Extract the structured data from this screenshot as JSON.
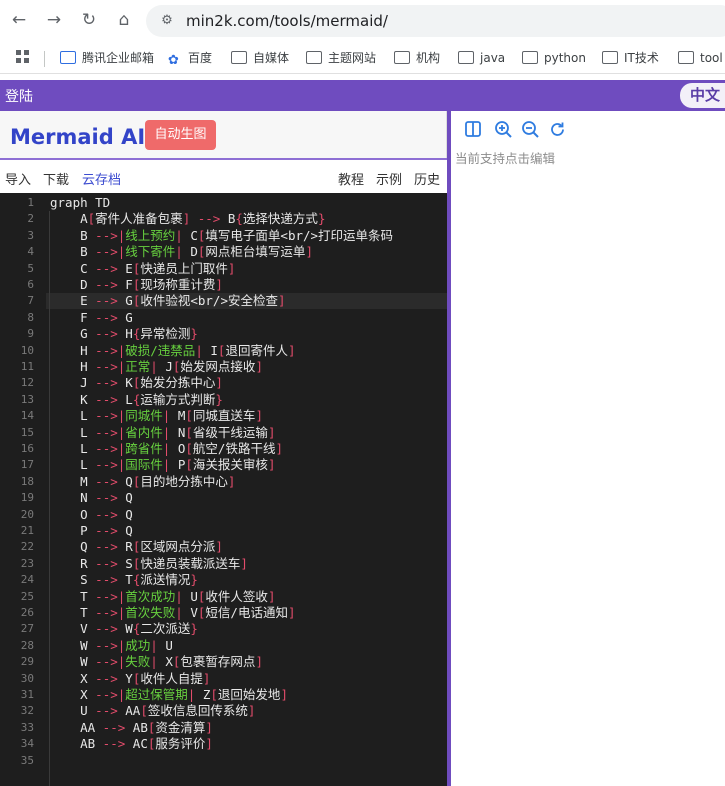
{
  "browser": {
    "url": "min2k.com/tools/mermaid/",
    "bookmarks": [
      "腾讯企业邮箱",
      "百度",
      "自媒体",
      "主题网站",
      "机构",
      "java",
      "python",
      "IT技术",
      "tool"
    ]
  },
  "app": {
    "login": "登陆",
    "lang": "中文",
    "brand": "Mermaid AI",
    "auto_button": "自动生图",
    "menu_left": [
      "导入",
      "下载",
      "云存档"
    ],
    "menu_right": [
      "教程",
      "示例",
      "历史"
    ],
    "hint": "当前支持点击编辑"
  },
  "code_lines": [
    [
      [
        "node",
        "graph TD"
      ]
    ],
    [
      [
        "node",
        "    A"
      ],
      [
        "br",
        "["
      ],
      [
        "text",
        "寄件人准备包裹"
      ],
      [
        "br",
        "]"
      ],
      [
        "arrow",
        " --> "
      ],
      [
        "node",
        "B"
      ],
      [
        "br",
        "{"
      ],
      [
        "text",
        "选择快递方式"
      ],
      [
        "br",
        "}"
      ]
    ],
    [
      [
        "node",
        "    B"
      ],
      [
        "arrow",
        " -->"
      ],
      [
        "br",
        "|"
      ],
      [
        "label",
        "线上预约"
      ],
      [
        "br",
        "|"
      ],
      [
        "node",
        " C"
      ],
      [
        "br",
        "["
      ],
      [
        "text",
        "填写电子面单<br/>打印运单条码"
      ]
    ],
    [
      [
        "node",
        "    B"
      ],
      [
        "arrow",
        " -->"
      ],
      [
        "br",
        "|"
      ],
      [
        "label",
        "线下寄件"
      ],
      [
        "br",
        "|"
      ],
      [
        "node",
        " D"
      ],
      [
        "br",
        "["
      ],
      [
        "text",
        "网点柜台填写运单"
      ],
      [
        "br",
        "]"
      ]
    ],
    [
      [
        "node",
        "    C"
      ],
      [
        "arrow",
        " --> "
      ],
      [
        "node",
        "E"
      ],
      [
        "br",
        "["
      ],
      [
        "text",
        "快递员上门取件"
      ],
      [
        "br",
        "]"
      ]
    ],
    [
      [
        "node",
        "    D"
      ],
      [
        "arrow",
        " --> "
      ],
      [
        "node",
        "F"
      ],
      [
        "br",
        "["
      ],
      [
        "text",
        "现场称重计费"
      ],
      [
        "br",
        "]"
      ]
    ],
    [
      [
        "node",
        "    E"
      ],
      [
        "arrow",
        " --> "
      ],
      [
        "node",
        "G"
      ],
      [
        "br",
        "["
      ],
      [
        "text",
        "收件验视<br/>安全检查"
      ],
      [
        "br",
        "]"
      ]
    ],
    [
      [
        "node",
        "    F"
      ],
      [
        "arrow",
        " --> "
      ],
      [
        "node",
        "G"
      ]
    ],
    [
      [
        "node",
        "    G"
      ],
      [
        "arrow",
        " --> "
      ],
      [
        "node",
        "H"
      ],
      [
        "br",
        "{"
      ],
      [
        "text",
        "异常检测"
      ],
      [
        "br",
        "}"
      ]
    ],
    [
      [
        "node",
        "    H"
      ],
      [
        "arrow",
        " -->"
      ],
      [
        "br",
        "|"
      ],
      [
        "label",
        "破损/违禁品"
      ],
      [
        "br",
        "|"
      ],
      [
        "node",
        " I"
      ],
      [
        "br",
        "["
      ],
      [
        "text",
        "退回寄件人"
      ],
      [
        "br",
        "]"
      ]
    ],
    [
      [
        "node",
        "    H"
      ],
      [
        "arrow",
        " -->"
      ],
      [
        "br",
        "|"
      ],
      [
        "label",
        "正常"
      ],
      [
        "br",
        "|"
      ],
      [
        "node",
        " J"
      ],
      [
        "br",
        "["
      ],
      [
        "text",
        "始发网点接收"
      ],
      [
        "br",
        "]"
      ]
    ],
    [
      [
        "node",
        "    J"
      ],
      [
        "arrow",
        " --> "
      ],
      [
        "node",
        "K"
      ],
      [
        "br",
        "["
      ],
      [
        "text",
        "始发分拣中心"
      ],
      [
        "br",
        "]"
      ]
    ],
    [
      [
        "node",
        "    K"
      ],
      [
        "arrow",
        " --> "
      ],
      [
        "node",
        "L"
      ],
      [
        "br",
        "{"
      ],
      [
        "text",
        "运输方式判断"
      ],
      [
        "br",
        "}"
      ]
    ],
    [
      [
        "node",
        "    L"
      ],
      [
        "arrow",
        " -->"
      ],
      [
        "br",
        "|"
      ],
      [
        "label",
        "同城件"
      ],
      [
        "br",
        "|"
      ],
      [
        "node",
        " M"
      ],
      [
        "br",
        "["
      ],
      [
        "text",
        "同城直送车"
      ],
      [
        "br",
        "]"
      ]
    ],
    [
      [
        "node",
        "    L"
      ],
      [
        "arrow",
        " -->"
      ],
      [
        "br",
        "|"
      ],
      [
        "label",
        "省内件"
      ],
      [
        "br",
        "|"
      ],
      [
        "node",
        " N"
      ],
      [
        "br",
        "["
      ],
      [
        "text",
        "省级干线运输"
      ],
      [
        "br",
        "]"
      ]
    ],
    [
      [
        "node",
        "    L"
      ],
      [
        "arrow",
        " -->"
      ],
      [
        "br",
        "|"
      ],
      [
        "label",
        "跨省件"
      ],
      [
        "br",
        "|"
      ],
      [
        "node",
        " O"
      ],
      [
        "br",
        "["
      ],
      [
        "text",
        "航空/铁路干线"
      ],
      [
        "br",
        "]"
      ]
    ],
    [
      [
        "node",
        "    L"
      ],
      [
        "arrow",
        " -->"
      ],
      [
        "br",
        "|"
      ],
      [
        "label",
        "国际件"
      ],
      [
        "br",
        "|"
      ],
      [
        "node",
        " P"
      ],
      [
        "br",
        "["
      ],
      [
        "text",
        "海关报关审核"
      ],
      [
        "br",
        "]"
      ]
    ],
    [
      [
        "node",
        "    M"
      ],
      [
        "arrow",
        " --> "
      ],
      [
        "node",
        "Q"
      ],
      [
        "br",
        "["
      ],
      [
        "text",
        "目的地分拣中心"
      ],
      [
        "br",
        "]"
      ]
    ],
    [
      [
        "node",
        "    N"
      ],
      [
        "arrow",
        " --> "
      ],
      [
        "node",
        "Q"
      ]
    ],
    [
      [
        "node",
        "    O"
      ],
      [
        "arrow",
        " --> "
      ],
      [
        "node",
        "Q"
      ]
    ],
    [
      [
        "node",
        "    P"
      ],
      [
        "arrow",
        " --> "
      ],
      [
        "node",
        "Q"
      ]
    ],
    [
      [
        "node",
        "    Q"
      ],
      [
        "arrow",
        " --> "
      ],
      [
        "node",
        "R"
      ],
      [
        "br",
        "["
      ],
      [
        "text",
        "区域网点分派"
      ],
      [
        "br",
        "]"
      ]
    ],
    [
      [
        "node",
        "    R"
      ],
      [
        "arrow",
        " --> "
      ],
      [
        "node",
        "S"
      ],
      [
        "br",
        "["
      ],
      [
        "text",
        "快递员装载派送车"
      ],
      [
        "br",
        "]"
      ]
    ],
    [
      [
        "node",
        "    S"
      ],
      [
        "arrow",
        " --> "
      ],
      [
        "node",
        "T"
      ],
      [
        "br",
        "{"
      ],
      [
        "text",
        "派送情况"
      ],
      [
        "br",
        "}"
      ]
    ],
    [
      [
        "node",
        "    T"
      ],
      [
        "arrow",
        " -->"
      ],
      [
        "br",
        "|"
      ],
      [
        "label",
        "首次成功"
      ],
      [
        "br",
        "|"
      ],
      [
        "node",
        " U"
      ],
      [
        "br",
        "["
      ],
      [
        "text",
        "收件人签收"
      ],
      [
        "br",
        "]"
      ]
    ],
    [
      [
        "node",
        "    T"
      ],
      [
        "arrow",
        " -->"
      ],
      [
        "br",
        "|"
      ],
      [
        "label",
        "首次失败"
      ],
      [
        "br",
        "|"
      ],
      [
        "node",
        " V"
      ],
      [
        "br",
        "["
      ],
      [
        "text",
        "短信/电话通知"
      ],
      [
        "br",
        "]"
      ]
    ],
    [
      [
        "node",
        "    V"
      ],
      [
        "arrow",
        " --> "
      ],
      [
        "node",
        "W"
      ],
      [
        "br",
        "{"
      ],
      [
        "text",
        "二次派送"
      ],
      [
        "br",
        "}"
      ]
    ],
    [
      [
        "node",
        "    W"
      ],
      [
        "arrow",
        " -->"
      ],
      [
        "br",
        "|"
      ],
      [
        "label",
        "成功"
      ],
      [
        "br",
        "|"
      ],
      [
        "node",
        " U"
      ]
    ],
    [
      [
        "node",
        "    W"
      ],
      [
        "arrow",
        " -->"
      ],
      [
        "br",
        "|"
      ],
      [
        "label",
        "失败"
      ],
      [
        "br",
        "|"
      ],
      [
        "node",
        " X"
      ],
      [
        "br",
        "["
      ],
      [
        "text",
        "包裹暂存网点"
      ],
      [
        "br",
        "]"
      ]
    ],
    [
      [
        "node",
        "    X"
      ],
      [
        "arrow",
        " --> "
      ],
      [
        "node",
        "Y"
      ],
      [
        "br",
        "["
      ],
      [
        "text",
        "收件人自提"
      ],
      [
        "br",
        "]"
      ]
    ],
    [
      [
        "node",
        "    X"
      ],
      [
        "arrow",
        " -->"
      ],
      [
        "br",
        "|"
      ],
      [
        "label",
        "超过保管期"
      ],
      [
        "br",
        "|"
      ],
      [
        "node",
        " Z"
      ],
      [
        "br",
        "["
      ],
      [
        "text",
        "退回始发地"
      ],
      [
        "br",
        "]"
      ]
    ],
    [
      [
        "node",
        "    U"
      ],
      [
        "arrow",
        " --> "
      ],
      [
        "node",
        "AA"
      ],
      [
        "br",
        "["
      ],
      [
        "text",
        "签收信息回传系统"
      ],
      [
        "br",
        "]"
      ]
    ],
    [
      [
        "node",
        "    AA"
      ],
      [
        "arrow",
        " --> "
      ],
      [
        "node",
        "AB"
      ],
      [
        "br",
        "["
      ],
      [
        "text",
        "资金清算"
      ],
      [
        "br",
        "]"
      ]
    ],
    [
      [
        "node",
        "    AB"
      ],
      [
        "arrow",
        " --> "
      ],
      [
        "node",
        "AC"
      ],
      [
        "br",
        "["
      ],
      [
        "text",
        "服务评价"
      ],
      [
        "br",
        "]"
      ]
    ],
    []
  ],
  "active_line": 7
}
